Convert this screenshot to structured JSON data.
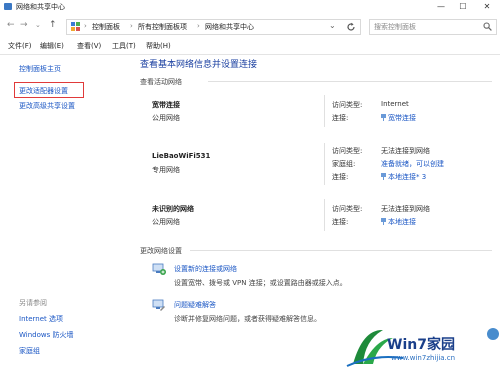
{
  "window": {
    "title": "网络和共享中心",
    "minimize": "—",
    "maximize": "☐",
    "close": "✕"
  },
  "nav": {
    "back": "←",
    "forward": "→",
    "up": "↑",
    "dropdown": "⌄"
  },
  "address": {
    "crumbs": [
      "控制面板",
      "所有控制面板项",
      "网络和共享中心"
    ],
    "separator": "›"
  },
  "search": {
    "placeholder": "搜索控制面板"
  },
  "menu": [
    "文件(F)",
    "编辑(E)",
    "查看(V)",
    "工具(T)",
    "帮助(H)"
  ],
  "sidebar": {
    "items": [
      "控制面板主页",
      "更改适配器设置",
      "更改高级共享设置"
    ],
    "see_also_label": "另请参阅",
    "see_also": [
      "Internet 选项",
      "Windows 防火墙",
      "家庭组"
    ]
  },
  "main": {
    "title": "查看基本网络信息并设置连接",
    "active_networks_label": "查看活动网络",
    "networks": [
      {
        "name": "宽带连接",
        "type": "公用网络",
        "access_key": "访问类型:",
        "access_value": "Internet",
        "conn_key": "连接:",
        "conn_value": "宽带连接"
      },
      {
        "name": "LieBaoWiFi531",
        "type": "专用网络",
        "access_key": "访问类型:",
        "access_value": "无法连接到网络",
        "homegroup_key": "家庭组:",
        "homegroup_value": "准备就绪，可以创建",
        "conn_key": "连接:",
        "conn_value": "本地连接* 3"
      },
      {
        "name": "未识别的网络",
        "type": "公用网络",
        "access_key": "访问类型:",
        "access_value": "无法连接到网络",
        "conn_key": "连接:",
        "conn_value": "本地连接"
      }
    ],
    "change_settings_label": "更改网络设置",
    "tasks": [
      {
        "link": "设置新的连接或网络",
        "desc": "设置宽带、拨号或 VPN 连接；或设置路由器或接入点。"
      },
      {
        "link": "问题疑难解答",
        "desc": "诊断并修复网络问题，或者获得疑难解答信息。"
      }
    ]
  },
  "watermark": {
    "text": "Win7家园",
    "url": "www.win7zhijia.cn"
  },
  "colors": {
    "link": "#1a56c4",
    "highlight_box": "#e03a3a",
    "title_blue": "#1a3fa0"
  }
}
